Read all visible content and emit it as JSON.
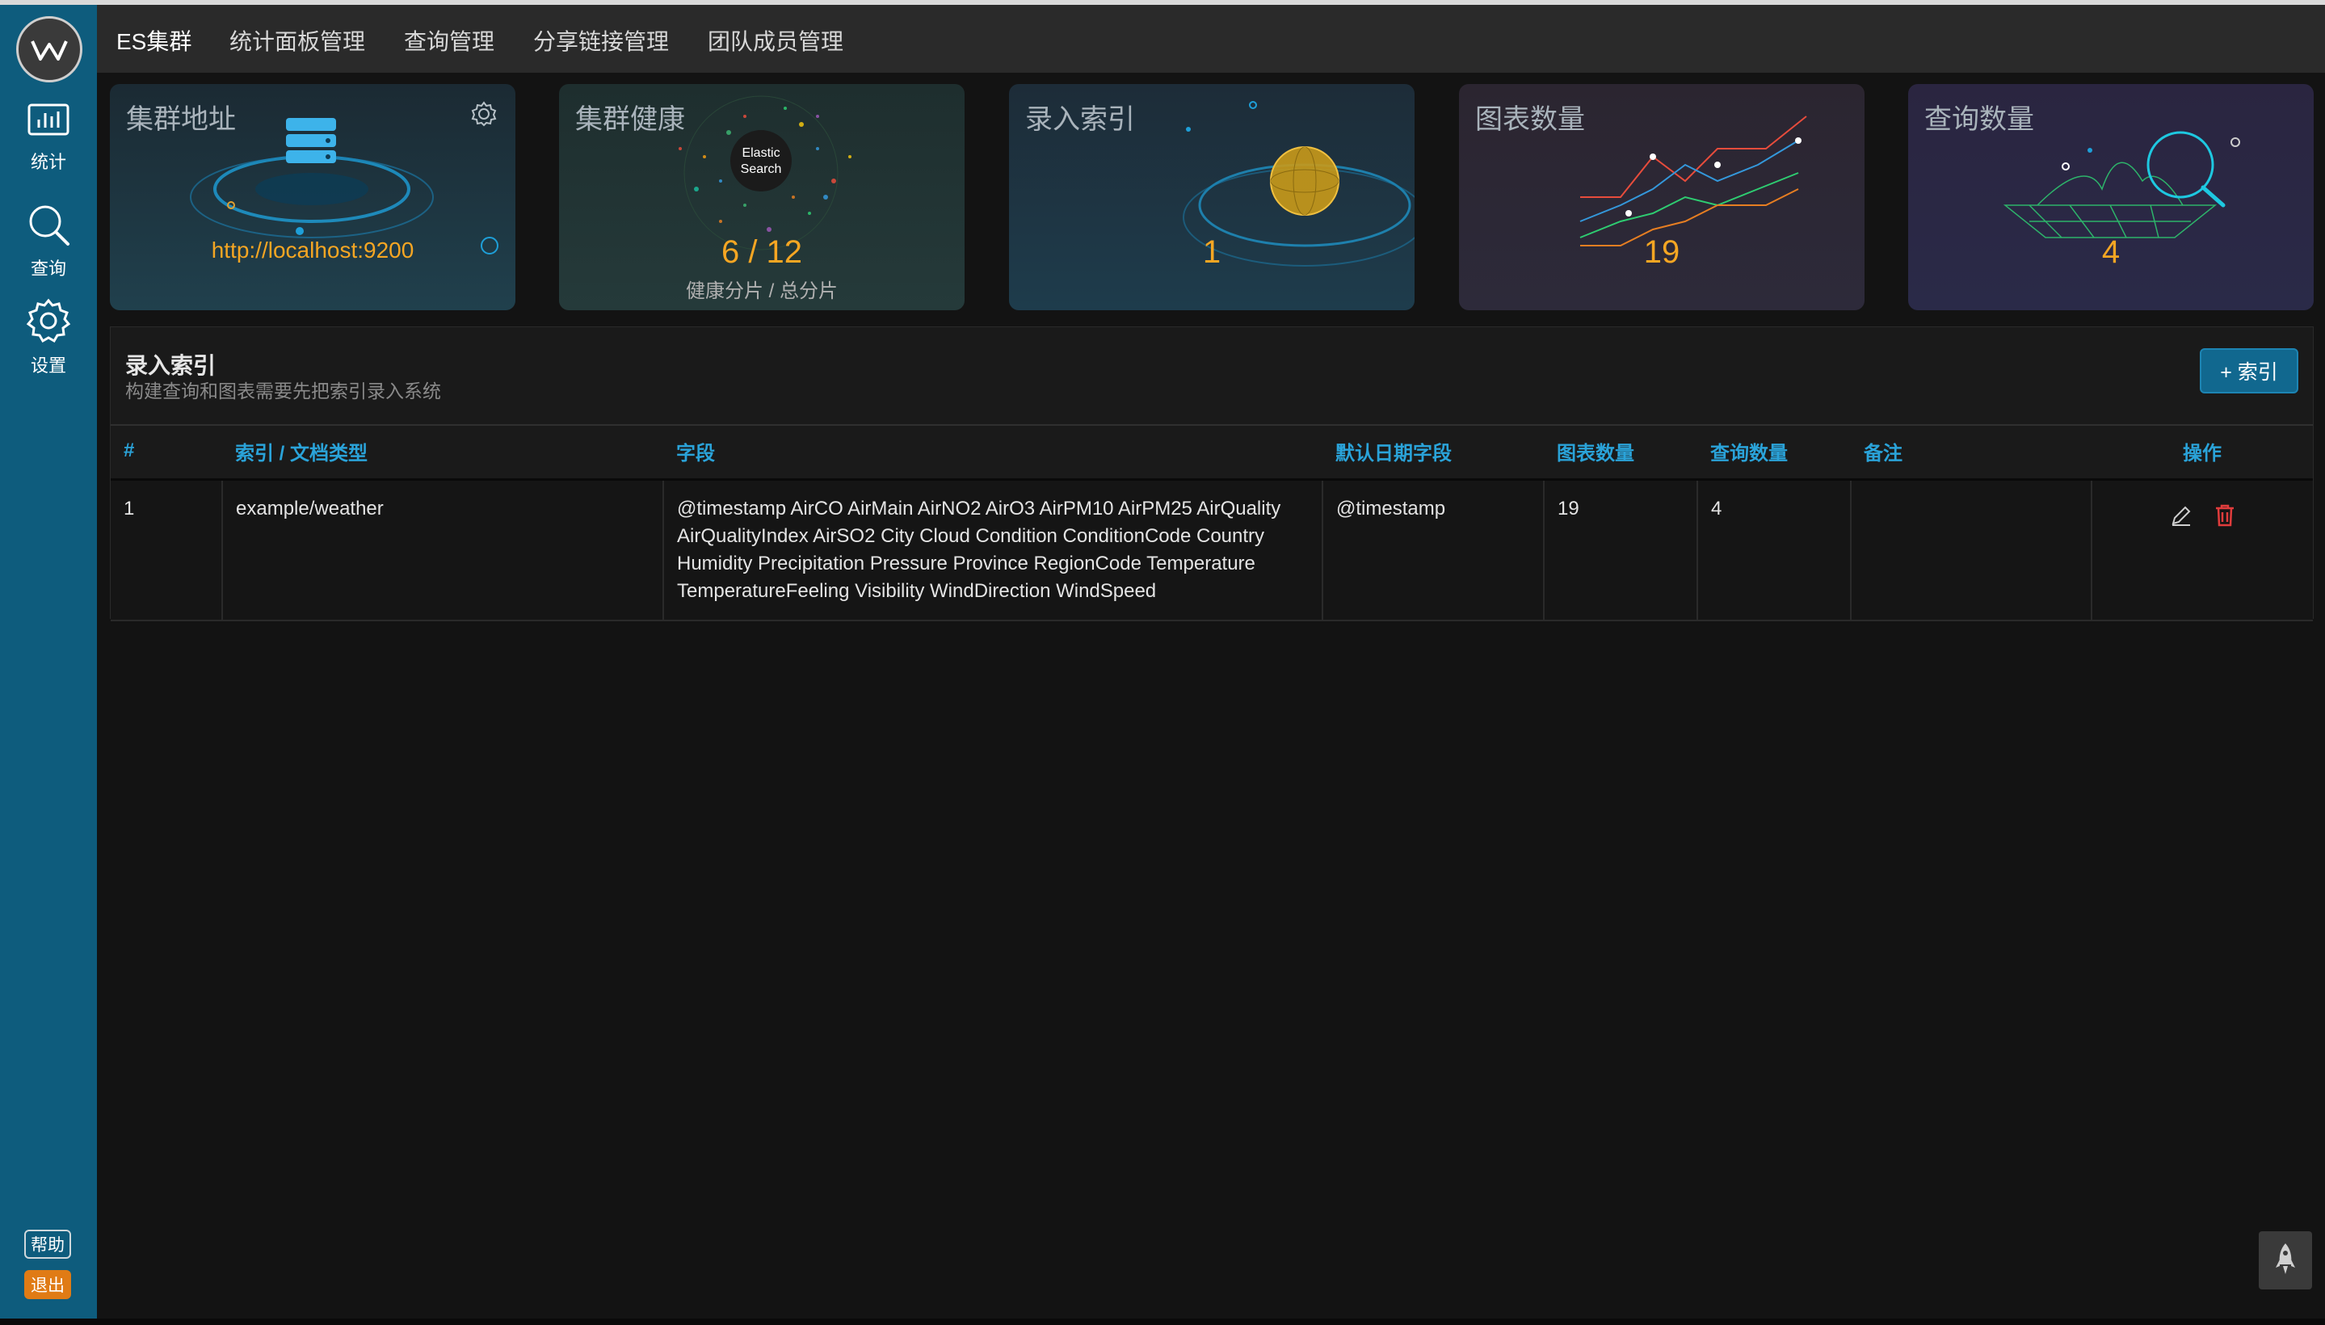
{
  "sidebar": {
    "logo_icon": "logo-w-icon",
    "items": [
      {
        "label": "统计",
        "icon": "bar-chart-icon"
      },
      {
        "label": "查询",
        "icon": "search-icon"
      },
      {
        "label": "设置",
        "icon": "gear-icon"
      }
    ],
    "help_label": "帮助",
    "logout_label": "退出"
  },
  "topnav": {
    "items": [
      {
        "label": "ES集群",
        "active": true
      },
      {
        "label": "统计面板管理",
        "active": false
      },
      {
        "label": "查询管理",
        "active": false
      },
      {
        "label": "分享链接管理",
        "active": false
      },
      {
        "label": "团队成员管理",
        "active": false
      }
    ]
  },
  "cards": [
    {
      "title": "集群地址",
      "value": "http://localhost:9200"
    },
    {
      "title": "集群健康",
      "value": "6 / 12",
      "sub": "健康分片 / 总分片",
      "art_text_1": "Elastic",
      "art_text_2": "Search"
    },
    {
      "title": "录入索引",
      "value": "1"
    },
    {
      "title": "图表数量",
      "value": "19"
    },
    {
      "title": "查询数量",
      "value": "4"
    }
  ],
  "panel": {
    "title": "录入索引",
    "subtitle": "构建查询和图表需要先把索引录入系统",
    "add_button": "+ 索引",
    "columns": [
      "#",
      "索引 / 文档类型",
      "字段",
      "默认日期字段",
      "图表数量",
      "查询数量",
      "备注",
      "操作"
    ],
    "rows": [
      {
        "num": "1",
        "index": "example/weather",
        "fields": "@timestamp AirCO AirMain AirNO2 AirO3 AirPM10 AirPM25 AirQuality AirQualityIndex AirSO2 City Cloud Condition ConditionCode Country Humidity Precipitation Pressure Province RegionCode Temperature TemperatureFeeling Visibility WindDirection WindSpeed",
        "date_field": "@timestamp",
        "charts": "19",
        "queries": "4",
        "note": ""
      }
    ]
  },
  "colors": {
    "sidebar": "#0e5c7d",
    "accent": "#2aa3d9",
    "value": "#f5a623",
    "logout": "#e07b15",
    "delete": "#e03c3c"
  }
}
